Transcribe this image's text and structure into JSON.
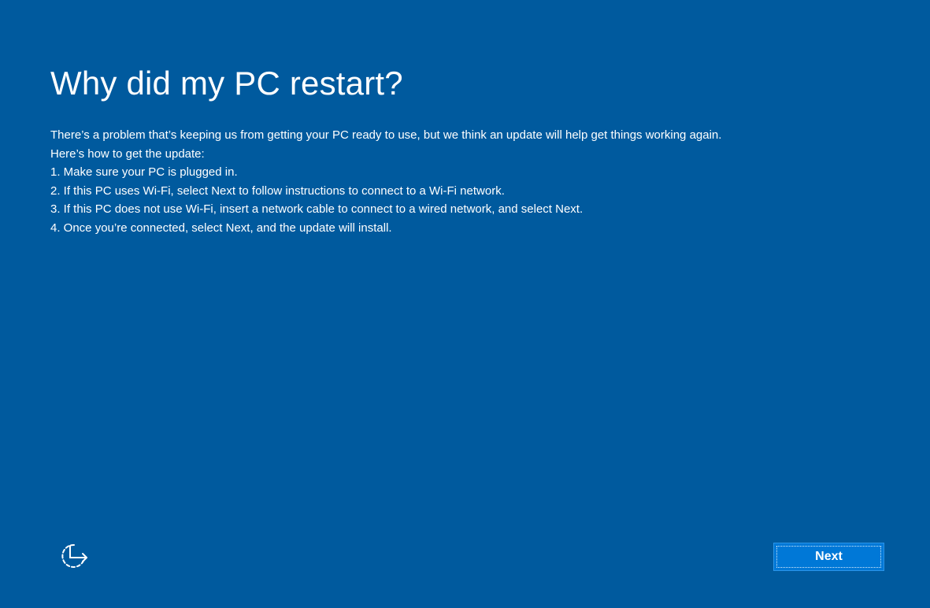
{
  "page": {
    "title": "Why did my PC restart?",
    "paragraphs": [
      "There’s a problem that’s keeping us from getting your PC ready to use, but we think an update will help get things working again.",
      "Here’s how to get the update:",
      "1. Make sure your PC is plugged in.",
      "2. If this PC uses Wi-Fi, select Next to follow instructions to connect to a Wi-Fi network.",
      "3. If this PC does not use Wi-Fi, insert a network cable to connect to a wired network, and select Next.",
      "4. Once you’re connected, select Next, and the update will install."
    ]
  },
  "footer": {
    "accessibility_icon": "ease-of-access-icon",
    "next_label": "Next"
  },
  "colors": {
    "background": "#005a9e",
    "button": "#0078d7",
    "text": "#ffffff"
  }
}
